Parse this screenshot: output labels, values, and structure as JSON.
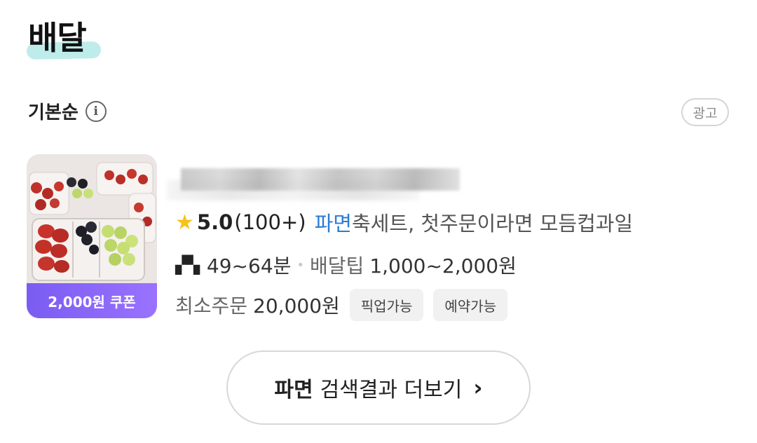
{
  "section": {
    "title": "배달"
  },
  "sort": {
    "label": "기본순",
    "info_icon": "info-icon"
  },
  "ad_badge": "광고",
  "store": {
    "coupon": "2,000원 쿠폰",
    "rating": "5.0",
    "review_count": "(100+)",
    "highlight_keyword": "파면",
    "menu_text": "축세트, 첫주문이라면 모듬컵과일",
    "delivery_time": "49~64분",
    "tip_label": "배달팁",
    "tip_value": "1,000~2,000원",
    "min_order_label": "최소주문",
    "min_order_value": "20,000원",
    "tags": [
      "픽업가능",
      "예약가능"
    ]
  },
  "more_button": {
    "keyword": "파면",
    "label": "검색결과 더보기"
  },
  "colors": {
    "coupon": "#7a5cf2",
    "keyword": "#2a7bd6",
    "star": "#f7c21a"
  }
}
